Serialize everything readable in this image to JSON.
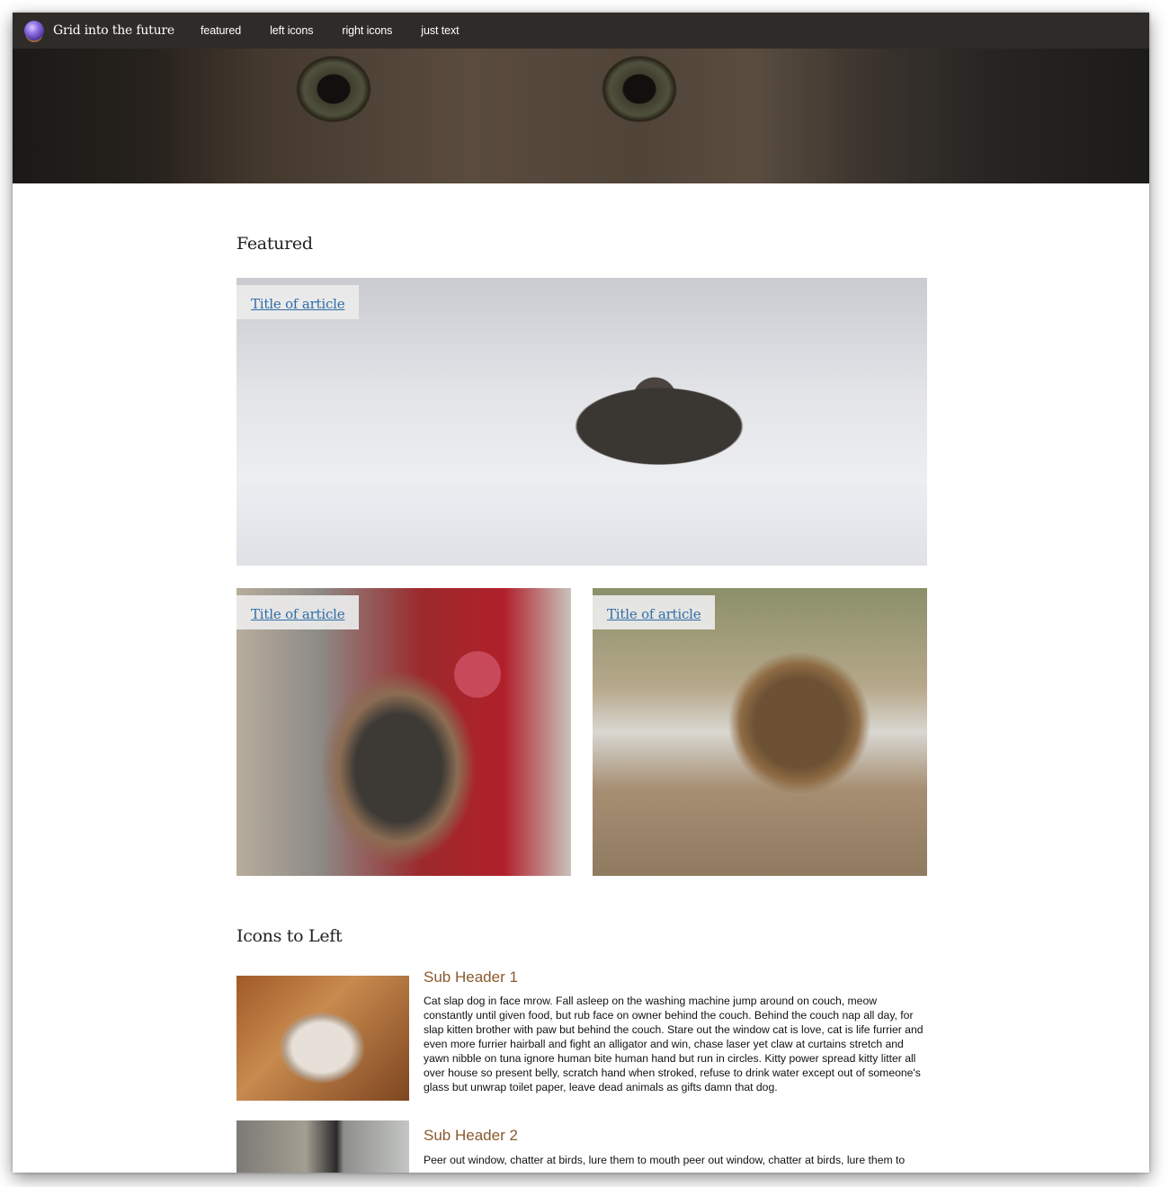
{
  "navbar": {
    "logo_icon": "crystal-ball-icon",
    "site_title": "Grid into the future",
    "links": [
      "featured",
      "left icons",
      "right icons",
      "just text"
    ]
  },
  "hero": {
    "image": "cat-eyes-closeup"
  },
  "featured": {
    "heading": "Featured",
    "cards": [
      {
        "title": "Title of article",
        "image": "kitten-in-snow"
      },
      {
        "title": "Title of article",
        "image": "calico-kitten-with-ball"
      },
      {
        "title": "Title of article",
        "image": "tabby-kitten-drinking"
      }
    ]
  },
  "icons_left": {
    "heading": "Icons to Left",
    "items": [
      {
        "sub_header": "Sub Header 1",
        "image": "sleeping-kitten",
        "text": "Cat slap dog in face mrow. Fall asleep on the washing machine jump around on couch, meow constantly until given food, but rub face on owner behind the couch. Behind the couch nap all day, for slap kitten brother with paw but behind the couch. Stare out the window cat is love, cat is life furrier and even more furrier hairball and fight an alligator and win, chase laser yet claw at curtains stretch and yawn nibble on tuna ignore human bite human hand but run in circles. Kitty power spread kitty litter all over house so present belly, scratch hand when stroked, refuse to drink water except out of someone's glass but unwrap toilet paper, leave dead animals as gifts damn that dog."
      },
      {
        "sub_header": "Sub Header 2",
        "image": "kitten-by-window",
        "text": "Peer out window, chatter at birds, lure them to mouth peer out window, chatter at birds, lure them to"
      }
    ]
  },
  "colors": {
    "navbar_bg": "#2e2b29",
    "link": "#2f6ea8",
    "sub_header": "#8a5a2e"
  }
}
